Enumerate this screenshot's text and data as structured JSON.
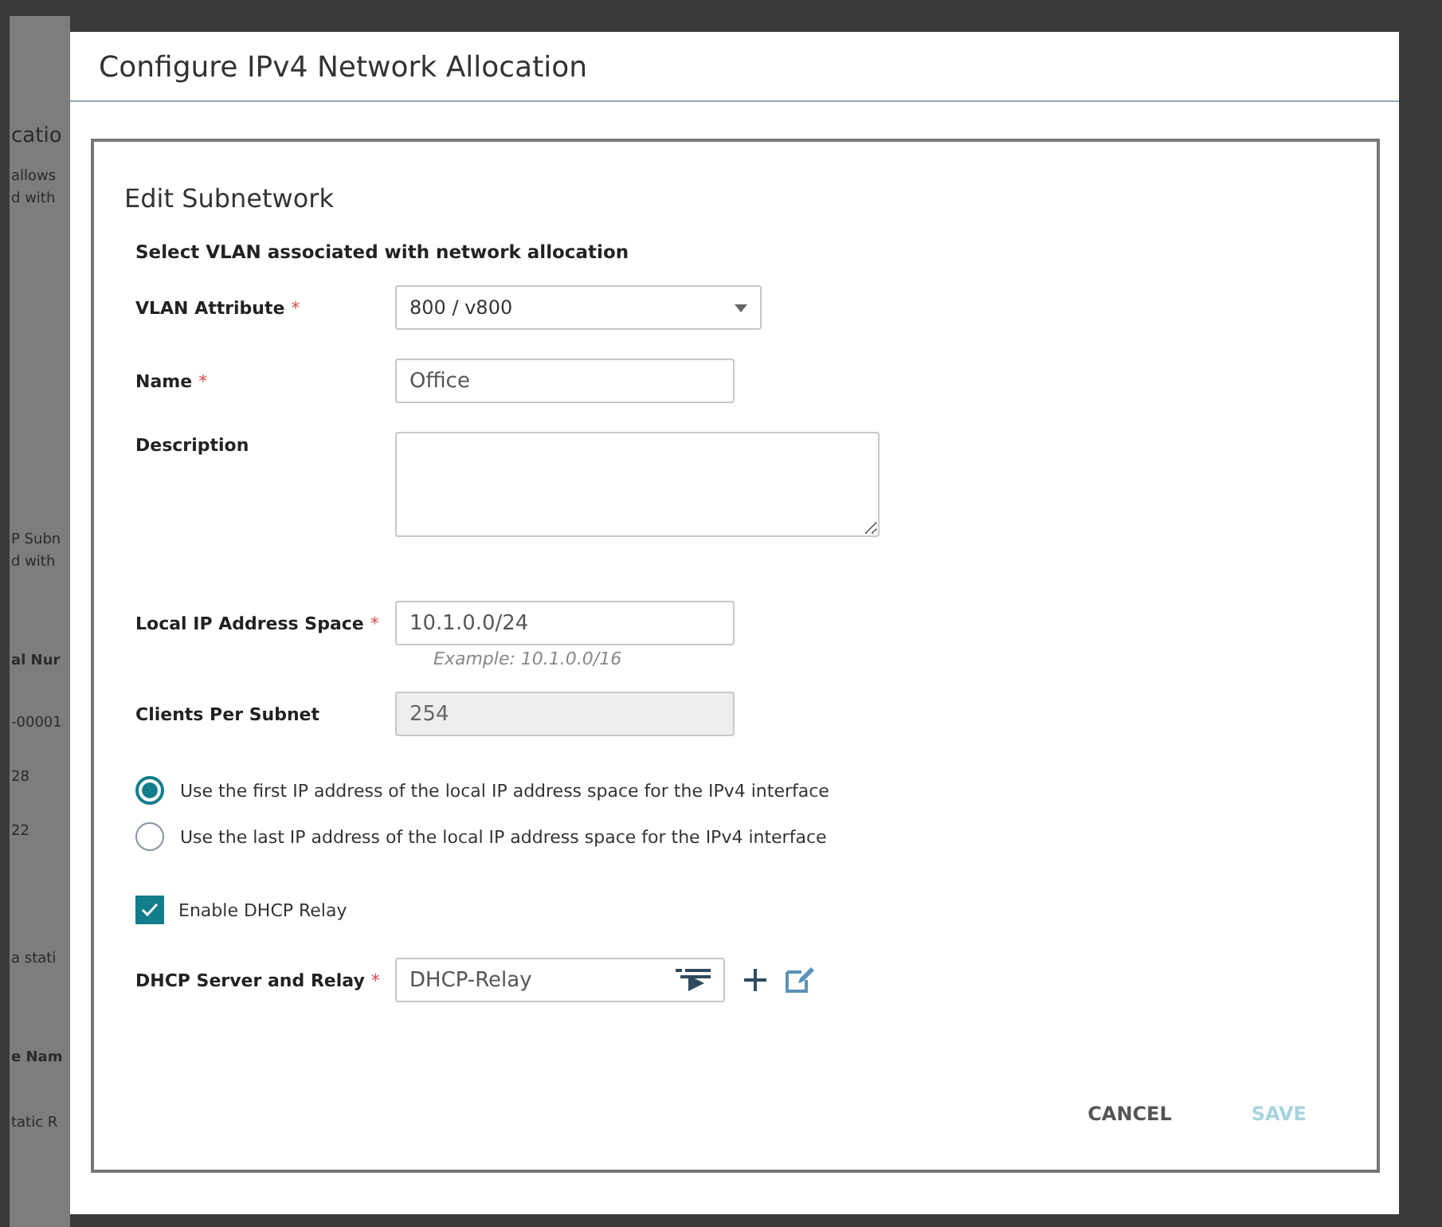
{
  "background_page": {
    "fragments": [
      {
        "kind": "heading",
        "text": "catio"
      },
      {
        "kind": "text",
        "text": "allows"
      },
      {
        "kind": "text",
        "text": "d with"
      },
      {
        "kind": "text",
        "text": "P Subn"
      },
      {
        "kind": "text",
        "text": "d with"
      },
      {
        "kind": "bold",
        "text": "al Nur"
      },
      {
        "kind": "cell",
        "text": "-00001"
      },
      {
        "kind": "cell",
        "text": "28"
      },
      {
        "kind": "cell",
        "text": "22"
      },
      {
        "kind": "text",
        "text": "a stati"
      },
      {
        "kind": "bold",
        "text": "e Nam"
      },
      {
        "kind": "cell",
        "text": "tatic R"
      }
    ]
  },
  "dialog": {
    "title": "Configure IPv4 Network Allocation",
    "heading": "Edit Subnetwork",
    "section_title": "Select VLAN associated with network allocation",
    "fields": [
      {
        "kind": "select",
        "label": "VLAN Attribute",
        "required_mark": "*",
        "value": "800 / v800"
      },
      {
        "kind": "input",
        "label": "Name",
        "required_mark": "*",
        "value": "Office"
      },
      {
        "kind": "textarea",
        "label": "Description"
      },
      {
        "kind": "input",
        "label": "Local IP Address Space",
        "required_mark": "*",
        "value": "10.1.0.0/24",
        "hint": "Example: 10.1.0.0/16"
      },
      {
        "kind": "readonly",
        "label": "Clients Per Subnet",
        "value": "254"
      }
    ],
    "radios": [
      {
        "label": "Use the first IP address of the local IP address space for the IPv4 interface",
        "selected": true
      },
      {
        "label": "Use the last IP address of the local IP address space for the IPv4 interface",
        "selected": false
      }
    ],
    "checkbox": {
      "label": "Enable DHCP Relay",
      "checked": true
    },
    "dhcp_field": {
      "label": "DHCP Server and Relay",
      "required_mark": "*",
      "value": "DHCP-Relay"
    },
    "buttons": [
      {
        "label": "CANCEL",
        "disabled": false
      },
      {
        "label": "SAVE",
        "disabled": true
      }
    ]
  }
}
